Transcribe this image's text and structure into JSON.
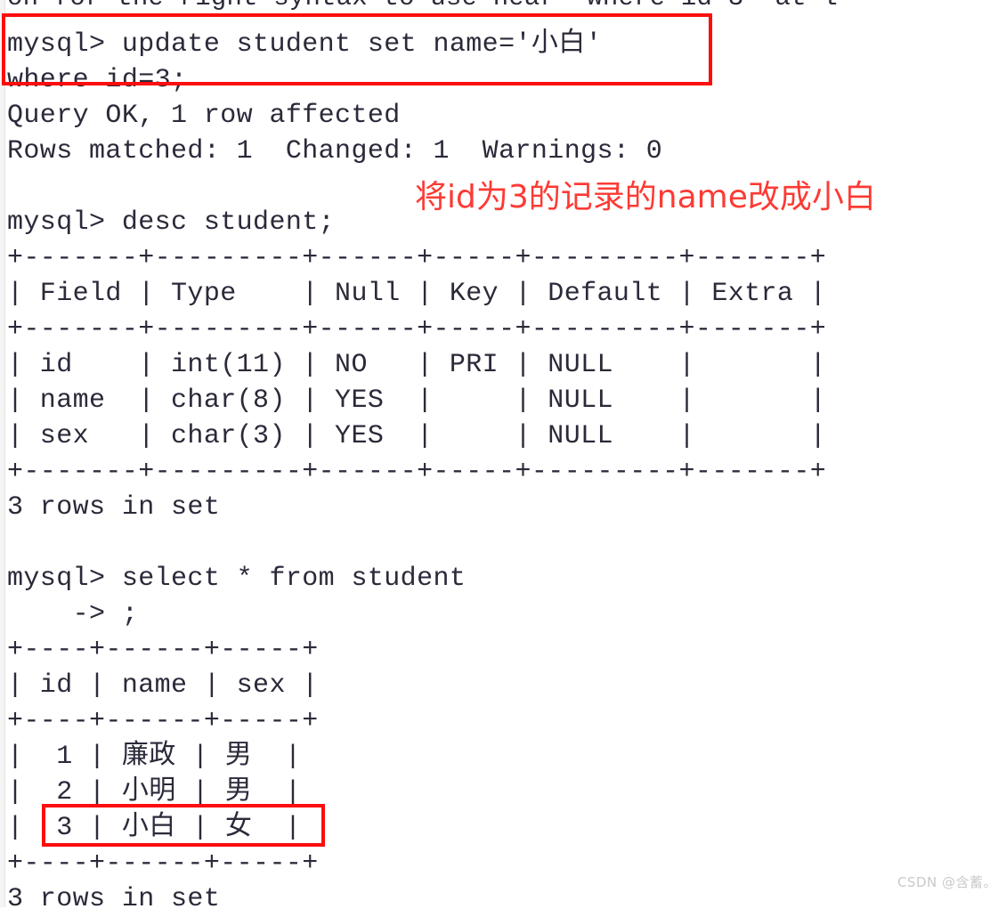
{
  "terminal": {
    "clipped_top_line": "on for the right syntax to use near 'where id 3' at l",
    "lines": [
      "",
      "mysql> update student set name='小白'",
      "where id=3;",
      "Query OK, 1 row affected",
      "Rows matched: 1  Changed: 1  Warnings: 0",
      "",
      "mysql> desc student;",
      "+-------+---------+------+-----+---------+-------+",
      "| Field | Type    | Null | Key | Default | Extra |",
      "+-------+---------+------+-----+---------+-------+",
      "| id    | int(11) | NO   | PRI | NULL    |       |",
      "| name  | char(8) | YES  |     | NULL    |       |",
      "| sex   | char(3) | YES  |     | NULL    |       |",
      "+-------+---------+------+-----+---------+-------+",
      "3 rows in set",
      "",
      "mysql> select * from student",
      "    -> ;",
      "+----+------+-----+",
      "| id | name | sex |",
      "+----+------+-----+",
      "|  1 | 廉政 | 男  |",
      "|  2 | 小明 | 男  |",
      "|  3 | 小白 | 女  |",
      "+----+------+-----+",
      "3 rows in set"
    ]
  },
  "commands": {
    "update_statement": "mysql> update student set name='小白' where id=3;",
    "update_result_1": "Query OK, 1 row affected",
    "update_result_2": "Rows matched: 1  Changed: 1  Warnings: 0",
    "desc_statement": "mysql> desc student;",
    "desc_footer": "3 rows in set",
    "select_statement": "mysql> select * from student",
    "select_continuation": "    -> ;",
    "select_footer": "3 rows in set"
  },
  "desc_table": {
    "headers": [
      "Field",
      "Type",
      "Null",
      "Key",
      "Default",
      "Extra"
    ],
    "rows": [
      [
        "id",
        "int(11)",
        "NO",
        "PRI",
        "NULL",
        ""
      ],
      [
        "name",
        "char(8)",
        "YES",
        "",
        "NULL",
        ""
      ],
      [
        "sex",
        "char(3)",
        "YES",
        "",
        "NULL",
        ""
      ]
    ]
  },
  "select_table": {
    "headers": [
      "id",
      "name",
      "sex"
    ],
    "rows": [
      [
        "1",
        "廉政",
        "男"
      ],
      [
        "2",
        "小明",
        "男"
      ],
      [
        "3",
        "小白",
        "女"
      ]
    ],
    "highlighted_row_index": 2
  },
  "annotation": {
    "text": "将id为3的记录的name改成小白",
    "color": "#fd3a34"
  },
  "highlights": {
    "box_color": "#fd0d0d",
    "update_box_label": "update-statement-highlight",
    "row_box_label": "result-row-3-highlight"
  },
  "watermark": {
    "text": "CSDN @含蓄。"
  },
  "colors": {
    "background": "#ffffff",
    "text": "#2a2a3a",
    "gutter": "#f4f4f4",
    "watermark": "#c9c9c9"
  }
}
